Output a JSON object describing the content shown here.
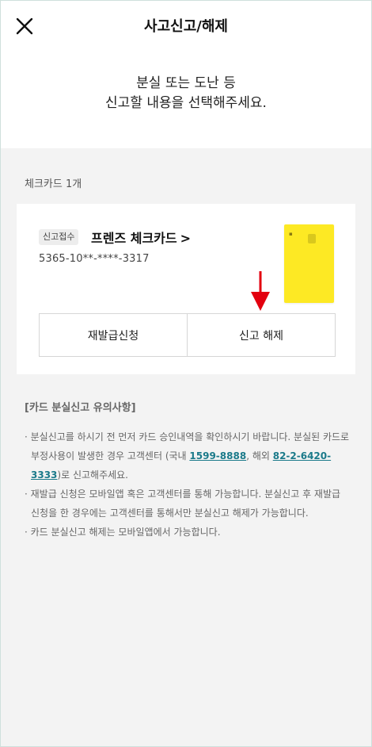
{
  "header": {
    "title": "사고신고/해제",
    "subtitle_line1": "분실 또는 도난 등",
    "subtitle_line2": "신고할 내용을 선택해주세요."
  },
  "card_section": {
    "count_label": "체크카드 1개",
    "card": {
      "status_badge": "신고접수",
      "name": "프렌즈 체크카드",
      "number": "5365-10**-****-3317",
      "color": "#fde924"
    },
    "buttons": {
      "reissue": "재발급신청",
      "release": "신고 해제"
    },
    "arrow_color": "#e3000f"
  },
  "notice": {
    "title": "[카드 분실신고 유의사항]",
    "item1_part1": "· 분실신고를 하시기 전 먼저 카드 승인내역을 확인하시기 바랍니다. 분실된 카드로 부정사용이 발생한 경우 고객센터 (국내 ",
    "domestic_phone": "1599-8888",
    "item1_part2": ", 해외 ",
    "overseas_phone": "82-2-6420-3333",
    "item1_part3": ")로 신고해주세요.",
    "item2": "· 재발급 신청은 모바일앱 혹은 고객센터를 통해 가능합니다. 분실신고 후 재발급 신청을 한 경우에는 고객센터를 통해서만 분실신고 해제가 가능합니다.",
    "item3": "· 카드 분실신고 해제는 모바일앱에서 가능합니다."
  }
}
